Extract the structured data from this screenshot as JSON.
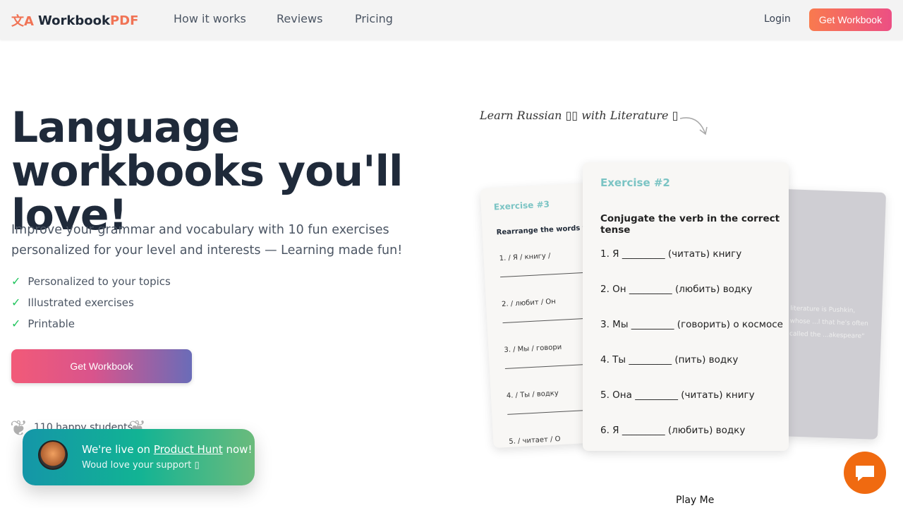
{
  "nav": {
    "logo_main": "Workbook",
    "logo_accent": "PDF",
    "links": [
      "How it works",
      "Reviews",
      "Pricing"
    ],
    "login": "Login",
    "cta": "Get Workbook"
  },
  "hero": {
    "title": "Language workbooks you'll love!",
    "subtitle": "Improve your grammar and vocabulary with 10 fun exercises personalized for your level and interests — Learning made fun!",
    "features": [
      "Personalized to your topics",
      "Illustrated exercises",
      "Printable"
    ],
    "cta": "Get Workbook",
    "students": "110 happy students"
  },
  "producthunt": {
    "line1_pre": "We're live on ",
    "line1_link": "Product Hunt",
    "line1_post": " now!",
    "line2": "Woud love your support ▯"
  },
  "preview": {
    "tagline": "Learn Russian ▯▯ with Literature ▯",
    "card_main": {
      "title": "Exercise #2",
      "instruction": "Conjugate the verb in the correct tense",
      "items": [
        "1.  Я _________ (читать) книгу",
        "2.  Он _________ (любить) водку",
        "3.  Мы _________ (говорить) о космосе",
        "4.  Ты _________ (пить) водку",
        "5.  Она _________ (читать) книгу",
        "6.  Я _________ (любить) водку"
      ]
    },
    "card_left": {
      "title": "Exercise #3",
      "instruction": "Rearrange the words to",
      "items": [
        "1.   /  Я  /   книгу  /",
        "2.   /   любит  /   Он",
        "3.   /   Мы  /   говори",
        "4.   /   Ты  /   водку",
        "5.   /   читает  /   О"
      ]
    },
    "card_back": {
      "text": "literature is Pushkin, whose ...l that he's often called the ...akespeare\""
    },
    "play": "Play Me"
  },
  "colors": {
    "accent": "#f07355",
    "check": "#22c55e",
    "chat": "#f06a10"
  }
}
